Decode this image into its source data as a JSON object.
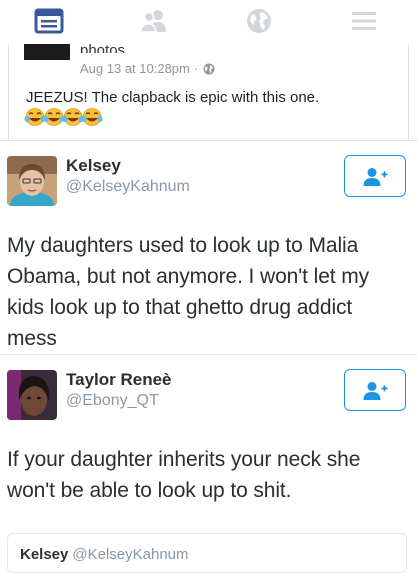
{
  "nav": {
    "items": [
      {
        "icon": "news-feed-icon",
        "active": true
      },
      {
        "icon": "friends-icon",
        "active": false
      },
      {
        "icon": "globe-icon",
        "active": false
      },
      {
        "icon": "menu-icon",
        "active": false
      }
    ],
    "active_color": "#3b5998",
    "inactive_color": "#d3d6db"
  },
  "fb_post": {
    "photos_label": "photos.",
    "date": "Aug 13 at 10:28pm ·",
    "text": "JEEZUS! The clapback is epic with this one.",
    "emoji_count": 4,
    "emoji_name": "crying-laughing-emoji"
  },
  "tweets": [
    {
      "name": "Kelsey",
      "handle": "@KelseyKahnum",
      "text": "My daughters used to look up to Malia Obama, but not anymore. I won't let my kids look up to that ghetto drug addict mess"
    },
    {
      "name": "Taylor Reneè",
      "handle": "@Ebony_QT",
      "text": "If your daughter inherits your neck she won't be able to look up to shit."
    }
  ],
  "quoted": {
    "name": "Kelsey",
    "handle": "@KelseyKahnum"
  },
  "colors": {
    "twitter_blue": "#1b95e0",
    "handle_gray": "#8899a6"
  }
}
